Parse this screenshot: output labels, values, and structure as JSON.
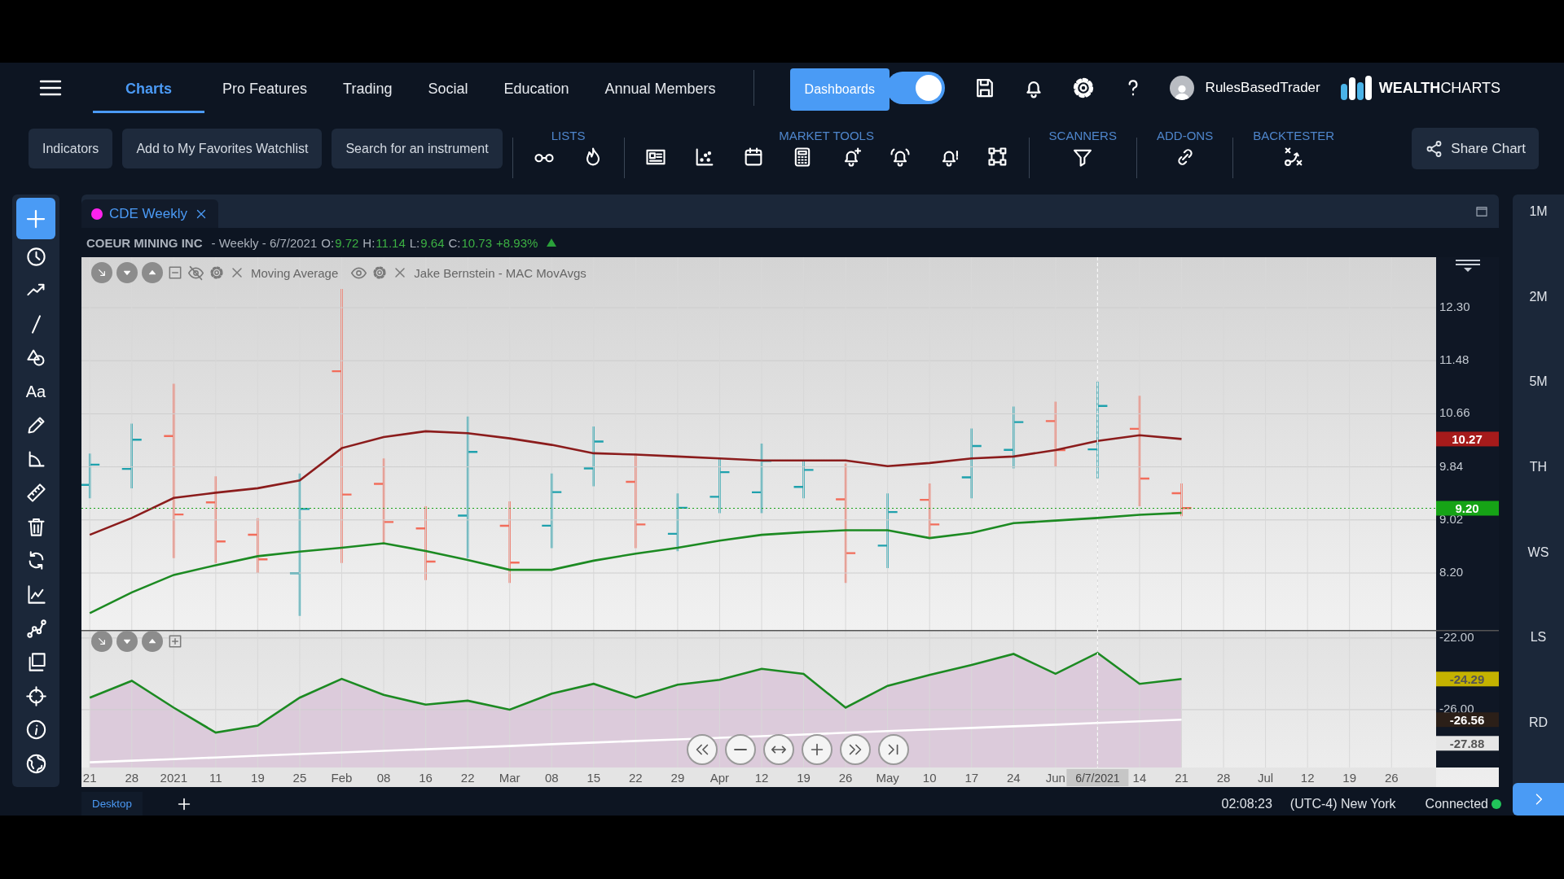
{
  "nav": {
    "tabs": [
      {
        "label": "Charts",
        "selected": true
      },
      {
        "label": "Pro Features",
        "selected": false
      },
      {
        "label": "Trading",
        "selected": false
      },
      {
        "label": "Social",
        "selected": false
      },
      {
        "label": "Education",
        "selected": false
      },
      {
        "label": "Annual Members",
        "selected": false
      }
    ],
    "dark_mode_toggle": {
      "on": true,
      "tooltip": "Dashboards"
    },
    "username": "RulesBasedTrader",
    "logo": "**WEALTH**CHARTS"
  },
  "toolbar": {
    "buttons": [
      "Indicators",
      "Add to My Favorites Watchlist",
      "Search for an instrument"
    ],
    "groups": [
      {
        "label": "LISTS",
        "kind": "lists"
      },
      {
        "label": "MARKET TOOLS",
        "kind": "market"
      },
      {
        "label": "SCANNERS",
        "kind": "scanners"
      },
      {
        "label": "ADD-ONS",
        "kind": "addons"
      },
      {
        "label": "BACKTESTER",
        "kind": "backtester"
      }
    ],
    "share_button": "Share Chart"
  },
  "drawing_tools": [
    {
      "kind": "add",
      "selected": true
    },
    {
      "kind": "clock",
      "selected": false
    },
    {
      "kind": "trend",
      "selected": false
    },
    {
      "kind": "line",
      "selected": false
    },
    {
      "kind": "shapes",
      "selected": false
    },
    {
      "kind": "text",
      "glyph": "Aa",
      "selected": false
    },
    {
      "kind": "pencil",
      "selected": false
    },
    {
      "kind": "angle",
      "selected": false
    },
    {
      "kind": "ruler",
      "selected": false
    },
    {
      "kind": "trash",
      "selected": false
    },
    {
      "kind": "refresh",
      "selected": false
    },
    {
      "kind": "chartline",
      "selected": false
    },
    {
      "kind": "nodecurve",
      "selected": false
    },
    {
      "kind": "copy",
      "selected": false
    },
    {
      "kind": "target",
      "selected": false
    },
    {
      "kind": "info",
      "selected": false
    },
    {
      "kind": "globe",
      "selected": false
    }
  ],
  "chart_tab": {
    "label": "CDE Weekly",
    "color": "#ff22ee"
  },
  "quote": {
    "name": "COEUR MINING INC",
    "period": "- Weekly - 6/7/2021",
    "fields": [
      {
        "label": "O:",
        "value": "9.72"
      },
      {
        "label": "H:",
        "value": "11.14"
      },
      {
        "label": "L:",
        "value": "9.64"
      },
      {
        "label": "C:",
        "value": "10.73"
      }
    ],
    "change": "+8.93%"
  },
  "price_pane": {
    "indicators": [
      {
        "label": "Moving Average",
        "visible": false
      },
      {
        "label": "Jake Bernstein - MAC MovAvgs",
        "visible": true
      }
    ],
    "chart_data": {
      "type": "line",
      "grid": true,
      "ylim": [
        7.32,
        13.08
      ],
      "yticks": [
        {
          "value": 8.2,
          "label": "8.20"
        },
        {
          "value": 9.02,
          "label": "9.02"
        },
        {
          "value": 9.84,
          "label": "9.84"
        },
        {
          "value": 10.66,
          "label": "10.66"
        },
        {
          "value": 11.48,
          "label": "11.48"
        },
        {
          "value": 12.3,
          "label": "12.30"
        }
      ],
      "series": [
        {
          "color": "#8b1c1c",
          "values": [
            8.79,
            9.05,
            9.36,
            9.44,
            9.51,
            9.63,
            10.13,
            10.3,
            10.39,
            10.36,
            10.28,
            10.18,
            10.05,
            10.03,
            10.0,
            9.97,
            9.94,
            9.94,
            9.94,
            9.85,
            9.9,
            9.97,
            10.0,
            10.1,
            10.24,
            10.33,
            10.27,
            null,
            null,
            null,
            null,
            null
          ]
        },
        {
          "color": "#1c8a22",
          "values": [
            7.58,
            7.9,
            8.17,
            8.32,
            8.46,
            8.53,
            8.59,
            8.66,
            8.54,
            8.4,
            8.25,
            8.25,
            8.39,
            8.5,
            8.59,
            8.7,
            8.79,
            8.83,
            8.86,
            8.86,
            8.74,
            8.82,
            8.97,
            9.01,
            9.05,
            9.1,
            9.13,
            null,
            null,
            null,
            null,
            null
          ]
        }
      ]
    },
    "markers": [
      {
        "label": "10.27",
        "color": "#a61b1b"
      },
      {
        "label": "9.20",
        "color": "#16a316",
        "line": true
      }
    ]
  },
  "oscillator_pane": {
    "chart_data": {
      "type": "line",
      "grid": true,
      "ylim": [
        -29.23,
        -21.55
      ],
      "categories": [
        "21",
        "28",
        "2021",
        "11",
        "19",
        "25",
        "Feb",
        "08",
        "16",
        "22",
        "Mar",
        "08",
        "15",
        "22",
        "29",
        "Apr",
        "12",
        "19",
        "26",
        "May",
        "10",
        "17",
        "24",
        "Jun",
        null,
        "14",
        "21",
        "28",
        "Jul",
        "12",
        "19",
        "26"
      ],
      "yticks": [
        {
          "value": -22,
          "label": "-22.00"
        },
        {
          "value": -26,
          "label": "-26.00"
        }
      ],
      "series": [
        {
          "color": "#1c8a22",
          "values": [
            -25.33,
            -24.39,
            -25.89,
            -27.28,
            -26.89,
            -25.33,
            -24.28,
            -25.17,
            -25.72,
            -25.5,
            -26.0,
            -25.11,
            -24.56,
            -25.33,
            -24.61,
            -24.33,
            -23.72,
            -24.0,
            -25.89,
            -24.67,
            -24.06,
            -23.5,
            -22.89,
            -24.0,
            -22.83,
            -24.56,
            -24.29,
            null,
            null,
            null,
            null,
            null
          ]
        },
        {
          "color": "#ffffff",
          "values": [
            -28.94,
            -28.85,
            -28.76,
            -28.67,
            -28.57,
            -28.48,
            -28.39,
            -28.3,
            -28.21,
            -28.12,
            -28.03,
            -27.93,
            -27.84,
            -27.75,
            -27.66,
            -27.57,
            -27.48,
            -27.39,
            -27.29,
            -27.2,
            -27.11,
            -27.02,
            -26.93,
            -26.84,
            -26.74,
            -26.65,
            -26.56,
            null,
            null,
            null,
            null,
            null
          ]
        }
      ]
    },
    "markers": [
      {
        "label": "-24.29",
        "color": "#c4b200"
      },
      {
        "label": "-26.56",
        "color": "#2b1f18"
      },
      {
        "label": "-27.88",
        "color": "#e6e6e6"
      }
    ],
    "crosshair_date": "6/7/2021"
  },
  "timeframes": [
    "1M",
    "2M",
    "5M",
    "TH",
    "WS",
    "LS",
    "RD"
  ],
  "status_bar": {
    "tabs": [
      {
        "label": "Desktop",
        "selected": true
      }
    ],
    "time": "02:08:23",
    "timezone": "(UTC-4) New York",
    "connection": "Connected",
    "connected": true
  }
}
